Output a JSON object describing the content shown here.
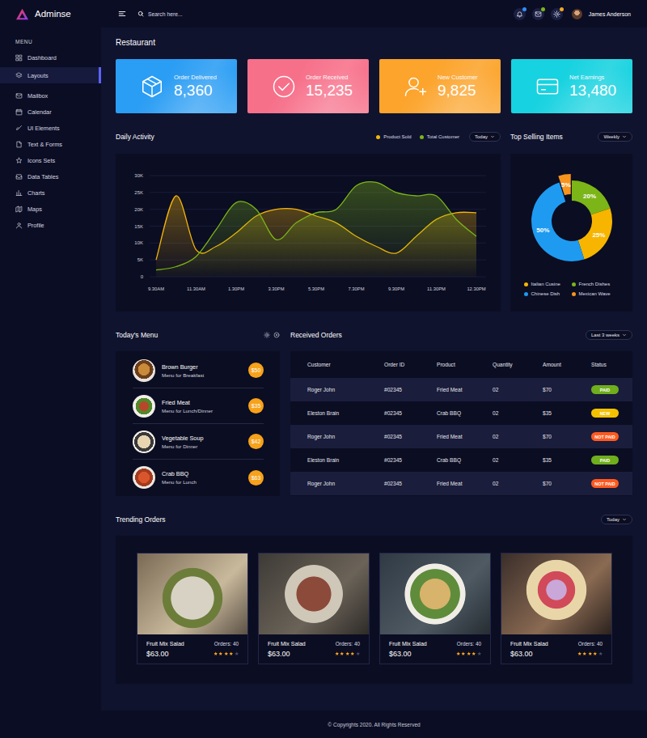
{
  "brand": {
    "name": "Adminse"
  },
  "topbar": {
    "search": {
      "placeholder": "Search here..."
    },
    "alerts": [
      {
        "color": "#2f8cff"
      },
      {
        "color": "#7cb518"
      },
      {
        "color": "#f5a623"
      }
    ],
    "user": {
      "name": "James Anderson"
    }
  },
  "sidebar": {
    "heading": "MENU",
    "items": [
      {
        "label": "Dashboard",
        "selected": false
      },
      {
        "label": "Layouts",
        "selected": true
      },
      {
        "label": "Mailbox",
        "selected": false
      },
      {
        "label": "Calendar",
        "selected": false
      },
      {
        "label": "UI Elements",
        "selected": false
      },
      {
        "label": "Text & Forms",
        "selected": false
      },
      {
        "label": "Icons Sets",
        "selected": false
      },
      {
        "label": "Data Tables",
        "selected": false
      },
      {
        "label": "Charts",
        "selected": false
      },
      {
        "label": "Maps",
        "selected": false
      },
      {
        "label": "Profile",
        "selected": false
      }
    ]
  },
  "page": {
    "title": "Restaurant"
  },
  "stats": [
    {
      "label": "Order Delivered",
      "value": "8,360",
      "color": "#2a9df4"
    },
    {
      "label": "Order Received",
      "value": "15,235",
      "color": "#f7708a"
    },
    {
      "label": "New Customer",
      "value": "9,825",
      "color": "#fca42c"
    },
    {
      "label": "Net Earnings",
      "value": "13,480",
      "color": "#17d2e0"
    }
  ],
  "activity": {
    "title": "Daily Activity",
    "filter": "Today",
    "y_ticks": [
      "30K",
      "25K",
      "20K",
      "15K",
      "10K",
      "5K",
      "0"
    ],
    "x_ticks": [
      "9.30AM",
      "11.30AM",
      "1.30PM",
      "3.30PM",
      "5.30PM",
      "7.30PM",
      "9.30PM",
      "11.30PM",
      "12.30PM"
    ],
    "series": [
      {
        "label": "Product Sold",
        "color": "#f5b50a",
        "values": [
          5000,
          24000,
          8000,
          9000,
          13000,
          18000,
          20000,
          20000,
          18000,
          16000,
          12000,
          9000,
          7000,
          12000,
          17000,
          19000,
          19000
        ]
      },
      {
        "label": "Total Customer",
        "color": "#7cb518",
        "values": [
          2000,
          3000,
          6000,
          14000,
          22000,
          20000,
          11000,
          16000,
          19000,
          20000,
          27000,
          28000,
          25000,
          24000,
          24000,
          17000,
          12000
        ]
      }
    ]
  },
  "top_selling": {
    "title": "Top Selling Items",
    "filter": "Weekly",
    "slices": [
      {
        "label": "French Dishes",
        "value": 20,
        "text": "20%",
        "color": "#7cb518",
        "exploded": false
      },
      {
        "label": "Italian Cusine",
        "value": 25,
        "text": "25%",
        "color": "#f7b500",
        "exploded": false
      },
      {
        "label": "Chinese Dish",
        "value": 50,
        "text": "50%",
        "color": "#1e9bf0",
        "exploded": false
      },
      {
        "label": "Mexican Wave",
        "value": 5,
        "text": "5%",
        "color": "#f7941d",
        "exploded": true
      }
    ],
    "legend_order": [
      1,
      0,
      2,
      3
    ]
  },
  "menu": {
    "title": "Today's Menu",
    "items": [
      {
        "name": "Brown Burger",
        "desc": "Menu for Breakfast",
        "price": "$50"
      },
      {
        "name": "Fried Meat",
        "desc": "Menu for Lunch/Dinner",
        "price": "$35"
      },
      {
        "name": "Vegetable Soup",
        "desc": "Menu for Dinner",
        "price": "$42"
      },
      {
        "name": "Crab BBQ",
        "desc": "Menu for Lunch",
        "price": "$63"
      }
    ]
  },
  "orders": {
    "title": "Received Orders",
    "filter": "Last 3 weeks",
    "columns": [
      "Customer",
      "Order ID",
      "Product",
      "Quantity",
      "Amount",
      "Status"
    ],
    "rows": [
      {
        "cells": [
          "Roger John",
          "#02345",
          "Fried Meat",
          "02",
          "$70"
        ],
        "status": {
          "label": "PAID",
          "color": "#6fae1c"
        }
      },
      {
        "cells": [
          "Eleston Brain",
          "#02345",
          "Crab BBQ",
          "02",
          "$35"
        ],
        "status": {
          "label": "NEW",
          "color": "#f2c200"
        }
      },
      {
        "cells": [
          "Roger John",
          "#02345",
          "Fried Meat",
          "02",
          "$70"
        ],
        "status": {
          "label": "NOT PAID",
          "color": "#ff5a1f"
        }
      },
      {
        "cells": [
          "Eleston Brain",
          "#02345",
          "Crab BBQ",
          "02",
          "$35"
        ],
        "status": {
          "label": "PAID",
          "color": "#6fae1c"
        }
      },
      {
        "cells": [
          "Roger John",
          "#02345",
          "Fried Meat",
          "02",
          "$70"
        ],
        "status": {
          "label": "NOT PAID",
          "color": "#ff5a1f"
        }
      }
    ]
  },
  "trending": {
    "title": "Trending Orders",
    "filter": "Today",
    "items": [
      {
        "name": "Fruit Mix Salad",
        "orders": "Orders: 40",
        "price": "$63.00",
        "stars": 4
      },
      {
        "name": "Fruit Mix Salad",
        "orders": "Orders: 40",
        "price": "$63.00",
        "stars": 4
      },
      {
        "name": "Fruit Mix Salad",
        "orders": "Orders: 40",
        "price": "$63.00",
        "stars": 4
      },
      {
        "name": "Fruit Mix Salad",
        "orders": "Orders: 40",
        "price": "$63.00",
        "stars": 4
      }
    ]
  },
  "footer": {
    "text": "© Copyrights 2020. All Rights Reserved"
  }
}
